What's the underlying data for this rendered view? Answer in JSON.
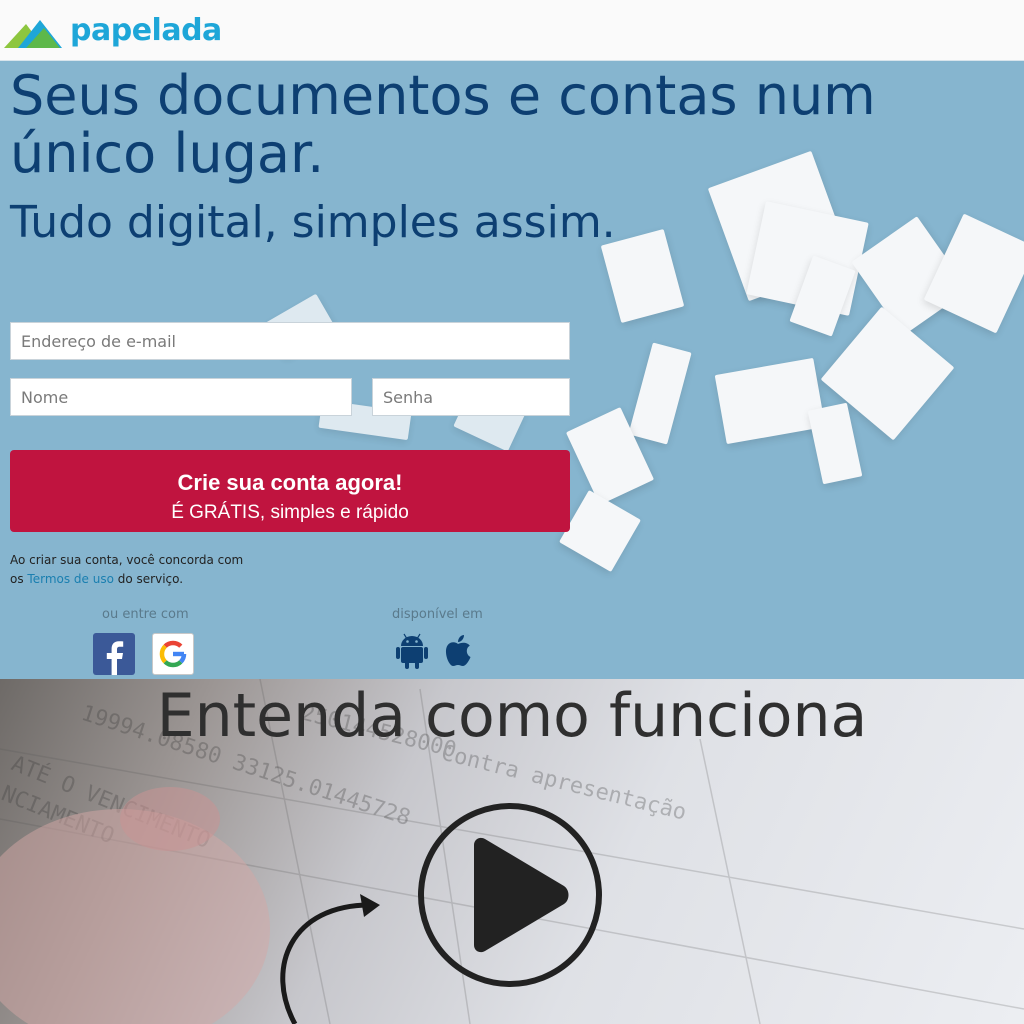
{
  "brand": {
    "name": "papelada"
  },
  "hero": {
    "headline": "Seus documentos e contas num único lugar.",
    "subheadline": "Tudo digital, simples assim."
  },
  "form": {
    "email_placeholder": "Endereço de e-mail",
    "name_placeholder": "Nome",
    "password_placeholder": "Senha",
    "cta_title": "Crie sua conta agora!",
    "cta_subtitle": "É GRÁTIS, simples e rápido"
  },
  "terms": {
    "prefix": "Ao criar sua conta, você concorda com os ",
    "link": "Termos de uso",
    "suffix": " do serviço."
  },
  "social": {
    "label": "ou entre com",
    "providers": [
      "facebook-icon",
      "google-icon"
    ]
  },
  "apps": {
    "label": "disponível em",
    "platforms": [
      "android-icon",
      "apple-icon"
    ]
  },
  "video": {
    "title": "Entenda como funciona"
  },
  "colors": {
    "hero_bg": "#86b5cf",
    "headline": "#0d3f72",
    "cta": "#c0143f",
    "brand": "#1ea6d8",
    "link": "#1a7fb0"
  }
}
